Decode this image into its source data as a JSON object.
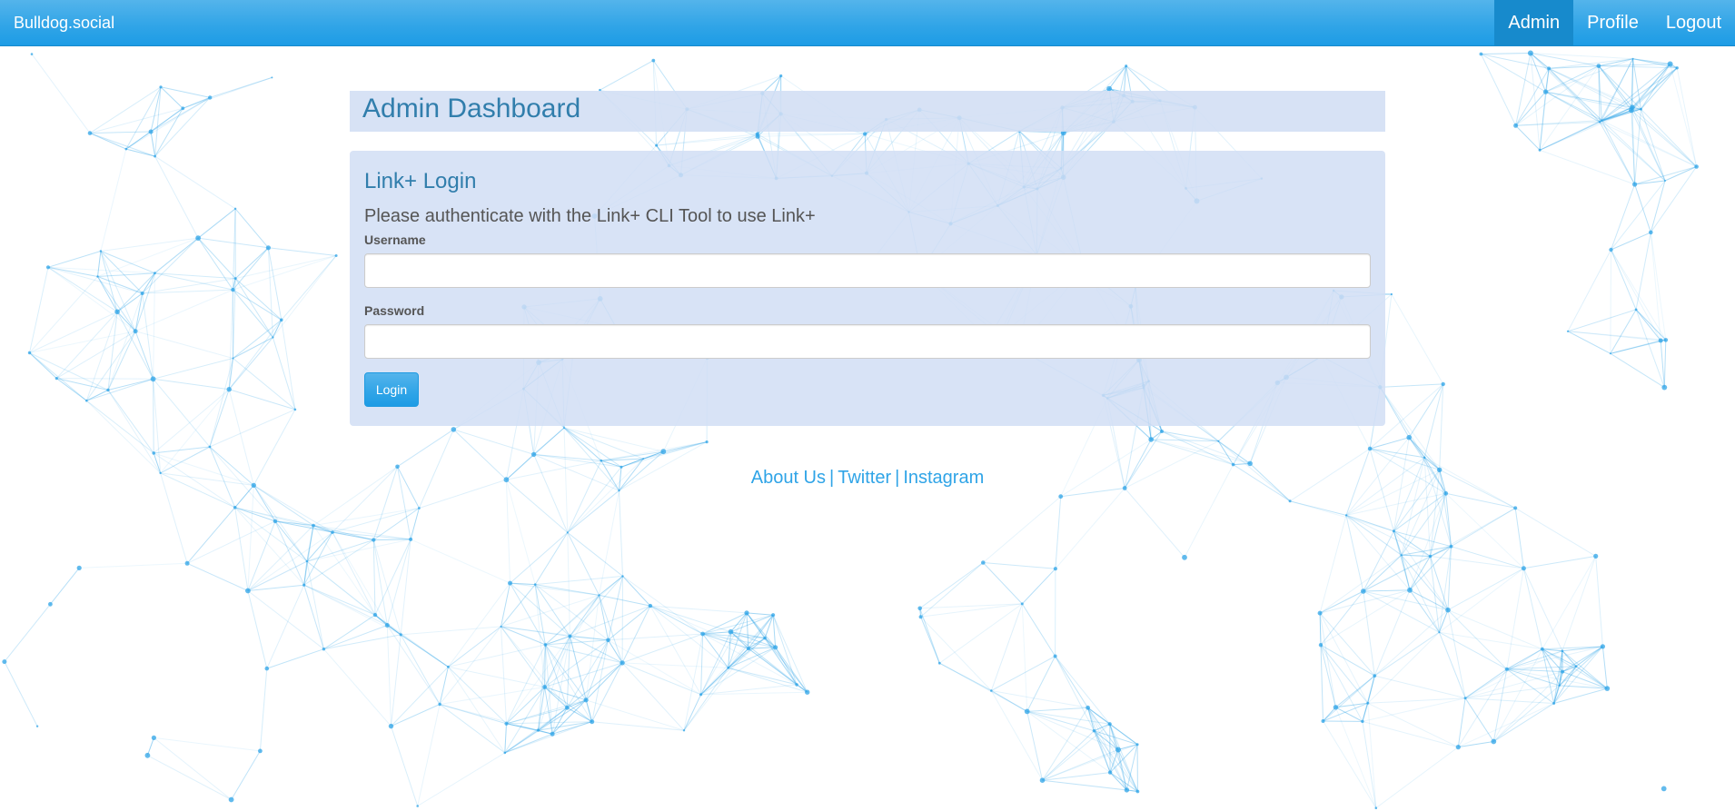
{
  "navbar": {
    "brand": "Bulldog.social",
    "items": [
      {
        "label": "Admin",
        "active": true
      },
      {
        "label": "Profile",
        "active": false
      },
      {
        "label": "Logout",
        "active": false
      }
    ]
  },
  "main": {
    "title": "Admin Dashboard",
    "panel": {
      "title": "Link+ Login",
      "description": "Please authenticate with the Link+ CLI Tool to use Link+",
      "username_label": "Username",
      "username_value": "",
      "password_label": "Password",
      "password_value": "",
      "login_label": "Login"
    }
  },
  "footer": {
    "links": [
      "About Us",
      "Twitter",
      "Instagram"
    ],
    "separator": "|"
  },
  "colors": {
    "accent": "#2fa4e7",
    "accent_dark": "#178acc",
    "heading": "#317eac",
    "panel_bg": "#d1def4",
    "network_lines": "#2fa4e7"
  },
  "background": {
    "pattern": "particle-network"
  }
}
